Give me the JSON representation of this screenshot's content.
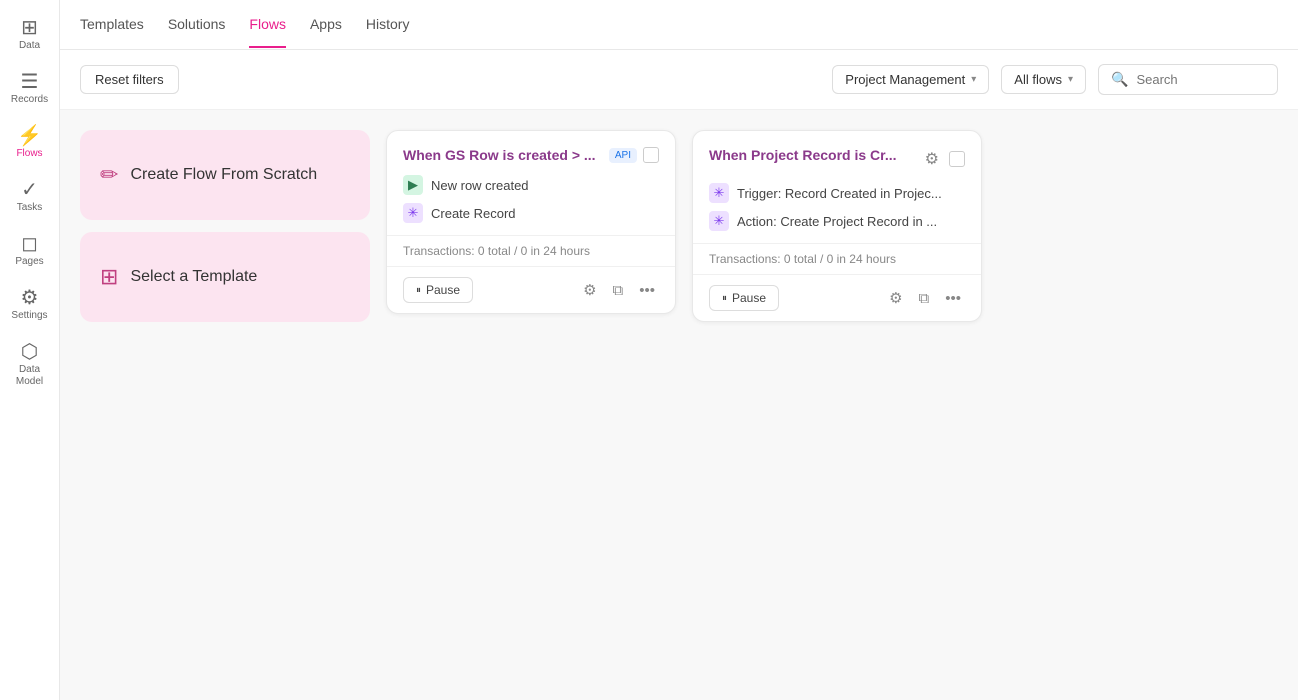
{
  "sidebar": {
    "items": [
      {
        "id": "data",
        "label": "Data",
        "icon": "⊞",
        "active": false
      },
      {
        "id": "records",
        "label": "Records",
        "icon": "☰",
        "active": false
      },
      {
        "id": "flows",
        "label": "Flows",
        "icon": "⚡",
        "active": true
      },
      {
        "id": "tasks",
        "label": "Tasks",
        "icon": "✓",
        "active": false
      },
      {
        "id": "pages",
        "label": "Pages",
        "icon": "◻",
        "active": false
      },
      {
        "id": "settings",
        "label": "Settings",
        "icon": "⚙",
        "active": false
      },
      {
        "id": "data-model",
        "label": "Data Model",
        "icon": "⬡",
        "active": false
      }
    ]
  },
  "topnav": {
    "items": [
      {
        "id": "templates",
        "label": "Templates",
        "active": false
      },
      {
        "id": "solutions",
        "label": "Solutions",
        "active": false
      },
      {
        "id": "flows",
        "label": "Flows",
        "active": true
      },
      {
        "id": "apps",
        "label": "Apps",
        "active": false
      },
      {
        "id": "history",
        "label": "History",
        "active": false
      }
    ]
  },
  "toolbar": {
    "reset_label": "Reset filters",
    "project_filter": "Project Management",
    "all_flows_label": "All flows",
    "search_placeholder": "Search"
  },
  "action_cards": [
    {
      "id": "create-from-scratch",
      "icon": "✏",
      "label": "Create Flow From Scratch"
    },
    {
      "id": "select-template",
      "icon": "⊞",
      "label": "Select a Template"
    }
  ],
  "flow_cards": [
    {
      "id": "flow-1",
      "title": "When GS Row is created > ...",
      "badge": "API",
      "steps": [
        {
          "icon": "▶",
          "icon_style": "green",
          "label": "New row created"
        },
        {
          "icon": "✳",
          "icon_style": "purple",
          "label": "Create Record"
        }
      ],
      "stats": "Transactions: 0 total / 0 in 24 hours",
      "pause_label": "Pause"
    },
    {
      "id": "flow-2",
      "title": "When Project Record is Cr...",
      "badge": null,
      "steps": [
        {
          "icon": "✳",
          "icon_style": "purple",
          "label": "Trigger: Record Created in Projec..."
        },
        {
          "icon": "✳",
          "icon_style": "purple",
          "label": "Action: Create Project Record in ..."
        }
      ],
      "stats": "Transactions: 0 total / 0 in 24 hours",
      "pause_label": "Pause"
    }
  ]
}
